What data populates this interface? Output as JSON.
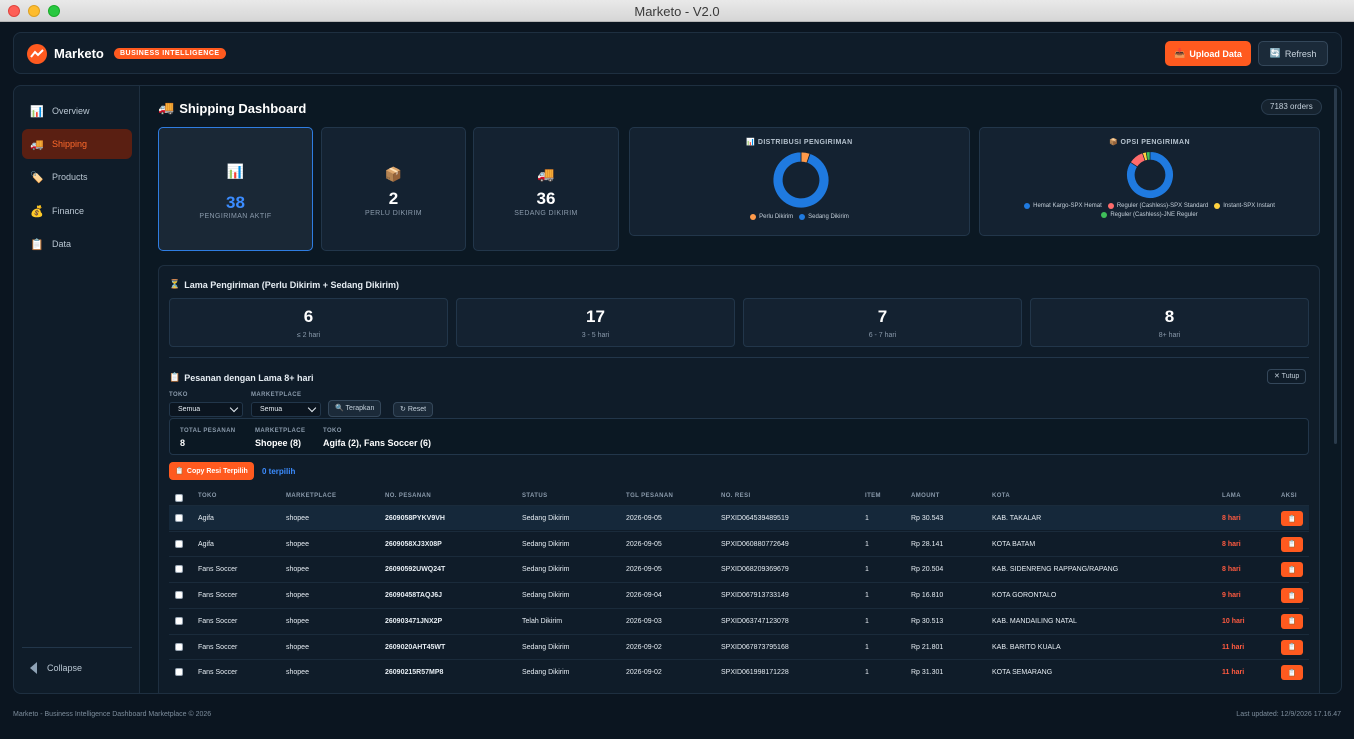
{
  "window": {
    "title": "Marketo - V2.0"
  },
  "header": {
    "brand": "Marketo",
    "badge": "BUSINESS INTELLIGENCE",
    "upload_label": "Upload Data",
    "refresh_label": "Refresh"
  },
  "sidebar": {
    "items": [
      {
        "label": "Overview",
        "icon": "chart-icon"
      },
      {
        "label": "Shipping",
        "icon": "truck-icon"
      },
      {
        "label": "Products",
        "icon": "tag-icon"
      },
      {
        "label": "Finance",
        "icon": "money-bag-icon"
      },
      {
        "label": "Data",
        "icon": "clipboard-icon"
      }
    ],
    "collapse_label": "Collapse"
  },
  "page": {
    "title": "Shipping Dashboard",
    "orders_badge": "7183 orders"
  },
  "stats": [
    {
      "value": "38",
      "label": "PENGIRIMAN AKTIF"
    },
    {
      "value": "2",
      "label": "PERLU DIKIRIM"
    },
    {
      "value": "36",
      "label": "SEDANG DIKIRIM"
    }
  ],
  "charts": {
    "distribusi": {
      "title": "DISTRIBUSI PENGIRIMAN"
    },
    "opsi": {
      "title": "OPSI PENGIRIMAN"
    }
  },
  "chart_data": [
    {
      "type": "pie",
      "title": "DISTRIBUSI PENGIRIMAN",
      "series": [
        {
          "name": "Perlu Dikirim",
          "value": 2,
          "color": "#ff9a4a"
        },
        {
          "name": "Sedang Dikirim",
          "value": 36,
          "color": "#1f7ae0"
        }
      ]
    },
    {
      "type": "pie",
      "title": "OPSI PENGIRIMAN",
      "series": [
        {
          "name": "Hemat Kargo-SPX Hemat",
          "value": 32,
          "color": "#1f7ae0"
        },
        {
          "name": "Reguler (Cashless)-SPX Standard",
          "value": 4,
          "color": "#ff6b6b"
        },
        {
          "name": "Instant-SPX Instant",
          "value": 1,
          "color": "#ffd23f"
        },
        {
          "name": "Reguler (Cashless)-JNE Reguler",
          "value": 1,
          "color": "#3fbf5a"
        }
      ]
    }
  ],
  "lama": {
    "title": "Lama Pengiriman (Perlu Dikirim + Sedang Dikirim)",
    "cards": [
      {
        "value": "6",
        "label": "≤ 2 hari"
      },
      {
        "value": "17",
        "label": "3 - 5 hari"
      },
      {
        "value": "7",
        "label": "6 - 7 hari"
      },
      {
        "value": "8",
        "label": "8+ hari"
      }
    ]
  },
  "pesanan": {
    "title": "Pesanan dengan Lama 8+ hari",
    "tutup_label": "✕ Tutup",
    "filters": {
      "toko_label": "TOKO",
      "toko_value": "Semua",
      "marketplace_label": "MARKETPLACE",
      "marketplace_value": "Semua",
      "terapkan_label": "Terapkan",
      "reset_label": "Reset"
    },
    "summary": {
      "total_label": "TOTAL PESANAN",
      "total_value": "8",
      "marketplace_label": "MARKETPLACE",
      "marketplace_value": "Shopee (8)",
      "toko_label": "TOKO",
      "toko_value": "Agifa (2), Fans Soccer (6)"
    },
    "copy_label": "Copy Resi Terpilih",
    "selected_label": "0 terpilih"
  },
  "table": {
    "headers": [
      "TOKO",
      "MARKETPLACE",
      "NO. PESANAN",
      "STATUS",
      "TGL PESANAN",
      "NO. RESI",
      "ITEM",
      "AMOUNT",
      "KOTA",
      "LAMA",
      "AKSI"
    ],
    "rows": [
      [
        "Agifa",
        "shopee",
        "2609058PYKV9VH",
        "Sedang Dikirim",
        "2026-09-05",
        "SPXID064539489519",
        "1",
        "Rp 30.543",
        "KAB. TAKALAR",
        "8 hari"
      ],
      [
        "Agifa",
        "shopee",
        "2609058XJ3X08P",
        "Sedang Dikirim",
        "2026-09-05",
        "SPXID060880772649",
        "1",
        "Rp 28.141",
        "KOTA BATAM",
        "8 hari"
      ],
      [
        "Fans Soccer",
        "shopee",
        "26090592UWQ24T",
        "Sedang Dikirim",
        "2026-09-05",
        "SPXID068209369679",
        "1",
        "Rp 20.504",
        "KAB. SIDENRENG RAPPANG/RAPANG",
        "8 hari"
      ],
      [
        "Fans Soccer",
        "shopee",
        "2609045​8TAQJ6J",
        "Sedang Dikirim",
        "2026-09-04",
        "SPXID067913733149",
        "1",
        "Rp 16.810",
        "KOTA GORONTALO",
        "9 hari"
      ],
      [
        "Fans Soccer",
        "shopee",
        "260903471JNX2P",
        "Telah Dikirim",
        "2026-09-03",
        "SPXID063747123078",
        "1",
        "Rp 30.513",
        "KAB. MANDAILING NATAL",
        "10 hari"
      ],
      [
        "Fans Soccer",
        "shopee",
        "2609020AHT45WT",
        "Sedang Dikirim",
        "2026-09-02",
        "SPXID067873795168",
        "1",
        "Rp 21.801",
        "KAB. BARITO KUALA",
        "11 hari"
      ],
      [
        "Fans Soccer",
        "shopee",
        "26090215R57MP8",
        "Sedang Dikirim",
        "2026-09-02",
        "SPXID061998171228",
        "1",
        "Rp 31.301",
        "KOTA SEMARANG",
        "11 hari"
      ]
    ]
  },
  "footer": {
    "left": "Marketo - Business Intelligence Dashboard Marketplace © 2026",
    "right": "Last updated: 12/9/2026 17.16.47"
  }
}
